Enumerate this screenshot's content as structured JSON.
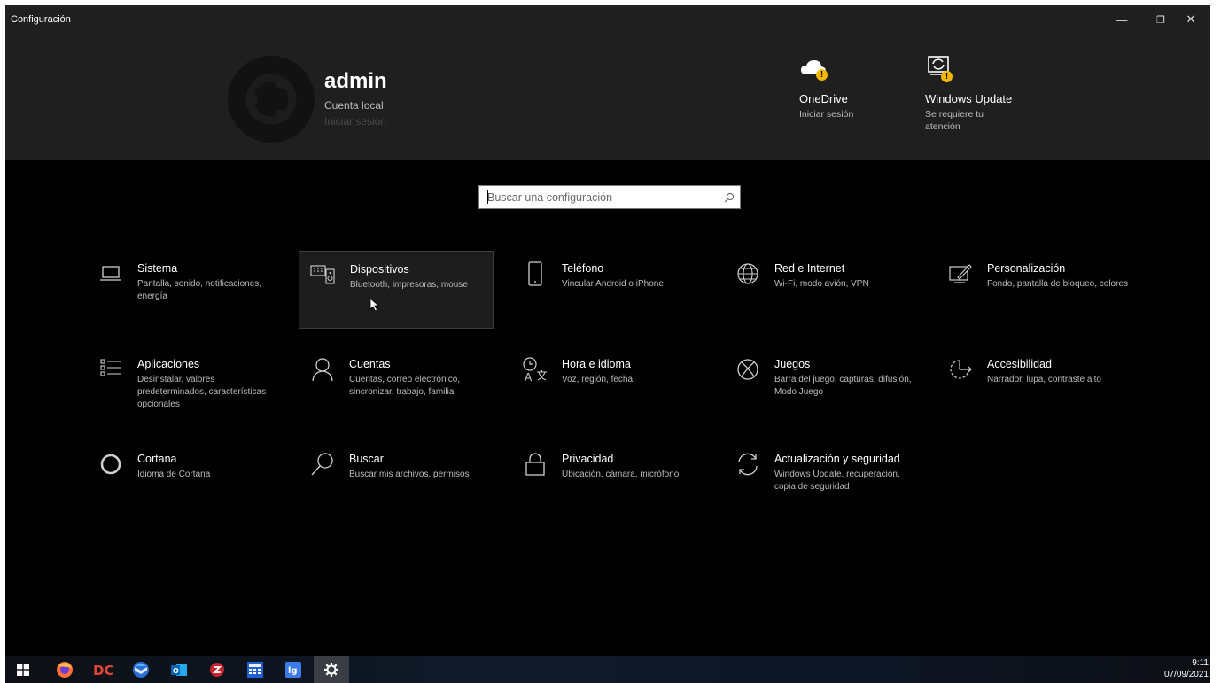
{
  "window": {
    "title": "Configuración",
    "controls": {
      "minimize": "—",
      "maximize": "❐",
      "close": "✕"
    }
  },
  "header": {
    "user": {
      "name": "admin",
      "account_type": "Cuenta local",
      "sign_in": "Iniciar sesión"
    },
    "onedrive": {
      "icon": "onedrive-cloud-icon",
      "title": "OneDrive",
      "subtitle": "Iniciar sesión"
    },
    "windows_update": {
      "icon": "windows-update-icon",
      "title": "Windows Update",
      "subtitle_line1": "Se requiere tu",
      "subtitle_line2": "atención"
    },
    "warning_glyph": "!",
    "warning_color": "#f2b705"
  },
  "search": {
    "placeholder": "Buscar una configuración",
    "value": ""
  },
  "tiles": [
    {
      "id": "sistema",
      "icon": "laptop-icon",
      "title": "Sistema",
      "description": "Pantalla, sonido, notificaciones, energía"
    },
    {
      "id": "dispositivos",
      "icon": "devices-icon",
      "title": "Dispositivos",
      "description": "Bluetooth, impresoras, mouse"
    },
    {
      "id": "telefono",
      "icon": "phone-icon",
      "title": "Teléfono",
      "description": "Vincular Android o iPhone"
    },
    {
      "id": "red",
      "icon": "globe-icon",
      "title": "Red e Internet",
      "description": "Wi-Fi, modo avión, VPN"
    },
    {
      "id": "personalizacion",
      "icon": "paintbrush-icon",
      "title": "Personalización",
      "description": "Fondo, pantalla de bloqueo, colores"
    },
    {
      "id": "aplicaciones",
      "icon": "apps-list-icon",
      "title": "Aplicaciones",
      "description": "Desinstalar, valores predeterminados, características opcionales"
    },
    {
      "id": "cuentas",
      "icon": "person-icon",
      "title": "Cuentas",
      "description": "Cuentas, correo electrónico, sincronizar, trabajo, familia"
    },
    {
      "id": "hora",
      "icon": "time-language-icon",
      "title": "Hora e idioma",
      "description": "Voz, región, fecha"
    },
    {
      "id": "juegos",
      "icon": "xbox-icon",
      "title": "Juegos",
      "description": "Barra del juego, capturas, difusión, Modo Juego"
    },
    {
      "id": "accesibilidad",
      "icon": "accessibility-icon",
      "title": "Accesibilidad",
      "description": "Narrador, lupa, contraste alto"
    },
    {
      "id": "cortana",
      "icon": "cortana-ring-icon",
      "title": "Cortana",
      "description": "Idioma de Cortana"
    },
    {
      "id": "buscar",
      "icon": "search-magnifier-icon",
      "title": "Buscar",
      "description": "Buscar mis archivos, permisos"
    },
    {
      "id": "privacidad",
      "icon": "lock-icon",
      "title": "Privacidad",
      "description": "Ubicación, cámara, micrófono"
    },
    {
      "id": "actualizacion",
      "icon": "sync-arrows-icon",
      "title": "Actualización y seguridad",
      "description": "Windows Update, recuperación, copia de seguridad"
    }
  ],
  "hovered_tile": "dispositivos",
  "taskbar": {
    "items": [
      {
        "icon": "windows-start-icon"
      },
      {
        "icon": "firefox-icon"
      },
      {
        "icon": "app-dc-icon"
      },
      {
        "icon": "thunderbird-icon"
      },
      {
        "icon": "outlook-icon"
      },
      {
        "icon": "app-red-icon"
      },
      {
        "icon": "calculator-icon"
      },
      {
        "icon": "app-lg-icon"
      },
      {
        "icon": "settings-gear-icon"
      }
    ],
    "clock": {
      "time": "9:11",
      "date": "07/09/2021"
    }
  }
}
